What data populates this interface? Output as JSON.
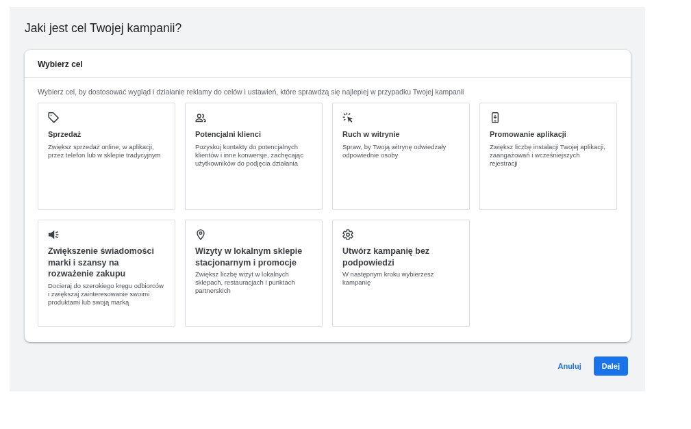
{
  "page": {
    "title": "Jaki jest cel Twojej kampanii?"
  },
  "panel": {
    "heading": "Wybierz cel",
    "description": "Wybierz cel, by dostosować wygląd i działanie reklamy do celów i ustawień, które sprawdzą się najlepiej w przypadku Twojej kampanii"
  },
  "goals": [
    {
      "title": "Sprzedaż",
      "description": "Zwiększ sprzedaż online, w aplikacji, przez telefon lub w sklepie tradycyjnym",
      "selected": false
    },
    {
      "title": "Potencjalni klienci",
      "description": "Pozyskuj kontakty do potencjalnych klientów i inne konwersje, zachęcając użytkowników do podjęcia działania",
      "selected": false
    },
    {
      "title": "Ruch w witrynie",
      "description": "Spraw, by Twoją witrynę odwiedzały odpowiednie osoby",
      "selected": false
    },
    {
      "title": "Promowanie aplikacji",
      "description": "Zwiększ liczbę instalacji Twojej aplikacji, zaangażowań i wcześniejszych rejestracji",
      "selected": false
    },
    {
      "title": "Zwiększenie świadomości marki i szansy na rozważenie zakupu",
      "description": "Docieraj do szerokiego kręgu odbiorców i zwiększaj zainteresowanie swoimi produktami lub swoją marką",
      "selected": false
    },
    {
      "title": "Wizyty w lokalnym sklepie stacjonarnym i promocje",
      "description": "Zwiększ liczbę wizyt w lokalnych sklepach, restauracjach i punktach partnerskich",
      "selected": false
    },
    {
      "title": "Utwórz kampanię bez podpowiedzi",
      "description": "W następnym kroku wybierzesz kampanię",
      "selected": false
    }
  ],
  "actions": [
    {
      "kind": "text",
      "label": "Anuluj"
    },
    {
      "kind": "primary",
      "label": "Dalej"
    }
  ]
}
